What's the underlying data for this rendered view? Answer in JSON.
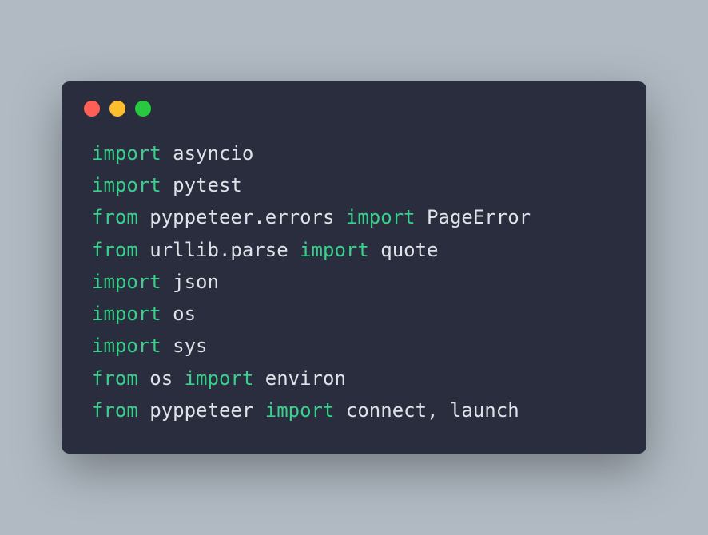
{
  "window": {
    "dots": [
      "red",
      "yellow",
      "green"
    ]
  },
  "code": {
    "lines": [
      {
        "tokens": [
          [
            "kw",
            "import"
          ],
          [
            "t",
            " asyncio"
          ]
        ]
      },
      {
        "tokens": [
          [
            "kw",
            "import"
          ],
          [
            "t",
            " pytest"
          ]
        ]
      },
      {
        "tokens": [
          [
            "kw",
            "from"
          ],
          [
            "t",
            " pyppeteer.errors "
          ],
          [
            "kw",
            "import"
          ],
          [
            "t",
            " PageError"
          ]
        ]
      },
      {
        "tokens": [
          [
            "kw",
            "from"
          ],
          [
            "t",
            " urllib.parse "
          ],
          [
            "kw",
            "import"
          ],
          [
            "t",
            " quote"
          ]
        ]
      },
      {
        "tokens": [
          [
            "kw",
            "import"
          ],
          [
            "t",
            " json"
          ]
        ]
      },
      {
        "tokens": [
          [
            "kw",
            "import"
          ],
          [
            "t",
            " os"
          ]
        ]
      },
      {
        "tokens": [
          [
            "kw",
            "import"
          ],
          [
            "t",
            " sys"
          ]
        ]
      },
      {
        "tokens": [
          [
            "kw",
            "from"
          ],
          [
            "t",
            " os "
          ],
          [
            "kw",
            "import"
          ],
          [
            "t",
            " environ"
          ]
        ]
      },
      {
        "tokens": [
          [
            "kw",
            "from"
          ],
          [
            "t",
            " pyppeteer "
          ],
          [
            "kw",
            "import"
          ],
          [
            "t",
            " connect, launch"
          ]
        ]
      }
    ]
  }
}
